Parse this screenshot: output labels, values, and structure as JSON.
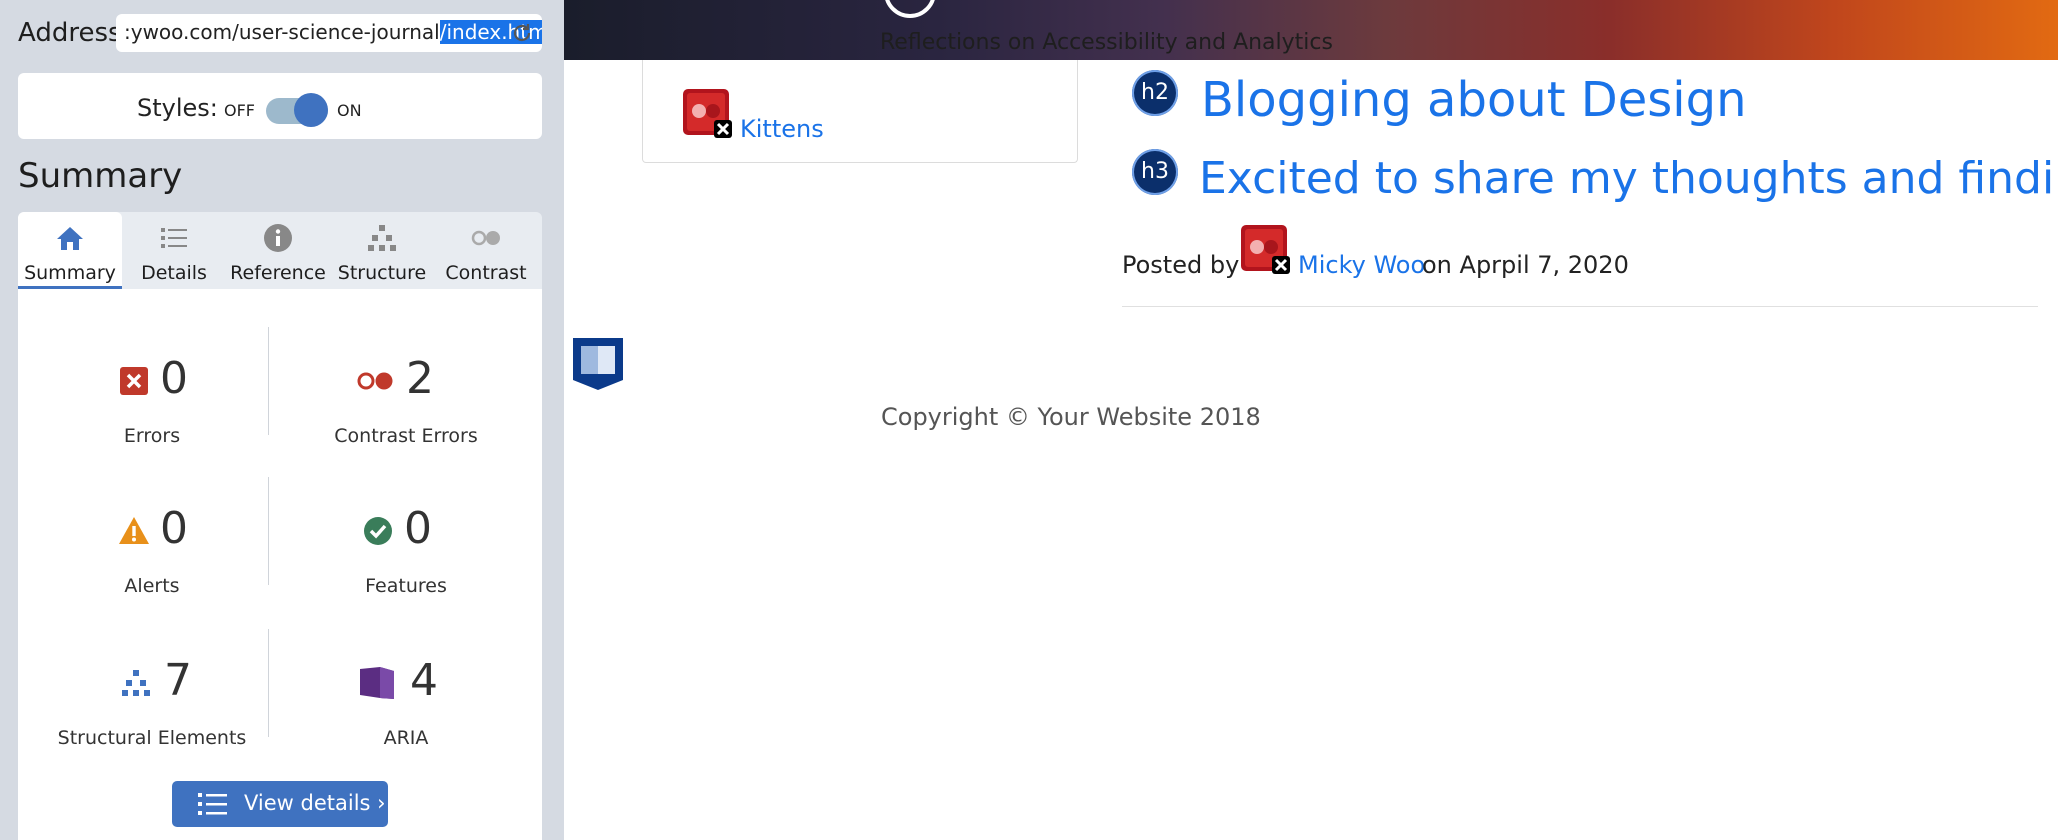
{
  "panel": {
    "address": {
      "label": "Address:",
      "value_start": ":ywoo.com/user-science-journal",
      "value_selected": "/index.html"
    },
    "styles": {
      "label": "Styles:",
      "off": "OFF",
      "on": "ON",
      "enabled": true
    },
    "summary_heading": "Summary",
    "tabs": [
      {
        "label": "Summary",
        "icon": "home-icon",
        "active": true
      },
      {
        "label": "Details",
        "icon": "list-icon",
        "active": false
      },
      {
        "label": "Reference",
        "icon": "info-icon",
        "active": false
      },
      {
        "label": "Structure",
        "icon": "hierarchy-icon",
        "active": false
      },
      {
        "label": "Contrast",
        "icon": "contrast-icon",
        "active": false
      }
    ],
    "stats": {
      "errors": {
        "count": "0",
        "label": "Errors"
      },
      "contrast_errors": {
        "count": "2",
        "label": "Contrast Errors"
      },
      "alerts": {
        "count": "0",
        "label": "Alerts"
      },
      "features": {
        "count": "0",
        "label": "Features"
      },
      "structural": {
        "count": "7",
        "label": "Structural Elements"
      },
      "aria": {
        "count": "4",
        "label": "ARIA"
      }
    },
    "view_details": "View details ›"
  },
  "page": {
    "tagline": "Reflections on Accessibility and Analytics",
    "sidebar_link": "Kittens",
    "h2": {
      "badge": "h2",
      "text": "Blogging about Design"
    },
    "h3": {
      "badge": "h3",
      "text": "Excited to share my thoughts and findings"
    },
    "posted_by": "Posted by",
    "author": "Micky Woo",
    "date": "on Aprpil 7, 2020",
    "copyright": "Copyright © Your Website 2018"
  },
  "colors": {
    "accent": "#3f72c0",
    "link": "#1a73e8",
    "error": "#c0392b",
    "alert": "#e8901a",
    "feature": "#3a7d5a",
    "aria": "#5b2d82"
  }
}
